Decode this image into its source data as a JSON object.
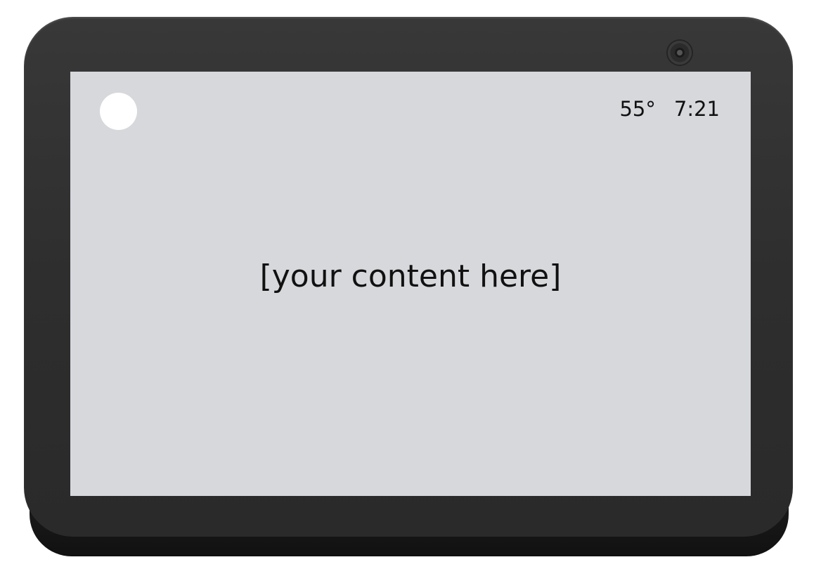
{
  "status_bar": {
    "temperature": "55°",
    "time": "7:21"
  },
  "main": {
    "content_placeholder": "[your content here]"
  },
  "colors": {
    "screen_background": "#d6d8dc",
    "bezel": "#2e2e2e",
    "text": "#111111",
    "avatar": "#ffffff"
  },
  "icons": [
    "camera-icon",
    "avatar-icon"
  ]
}
